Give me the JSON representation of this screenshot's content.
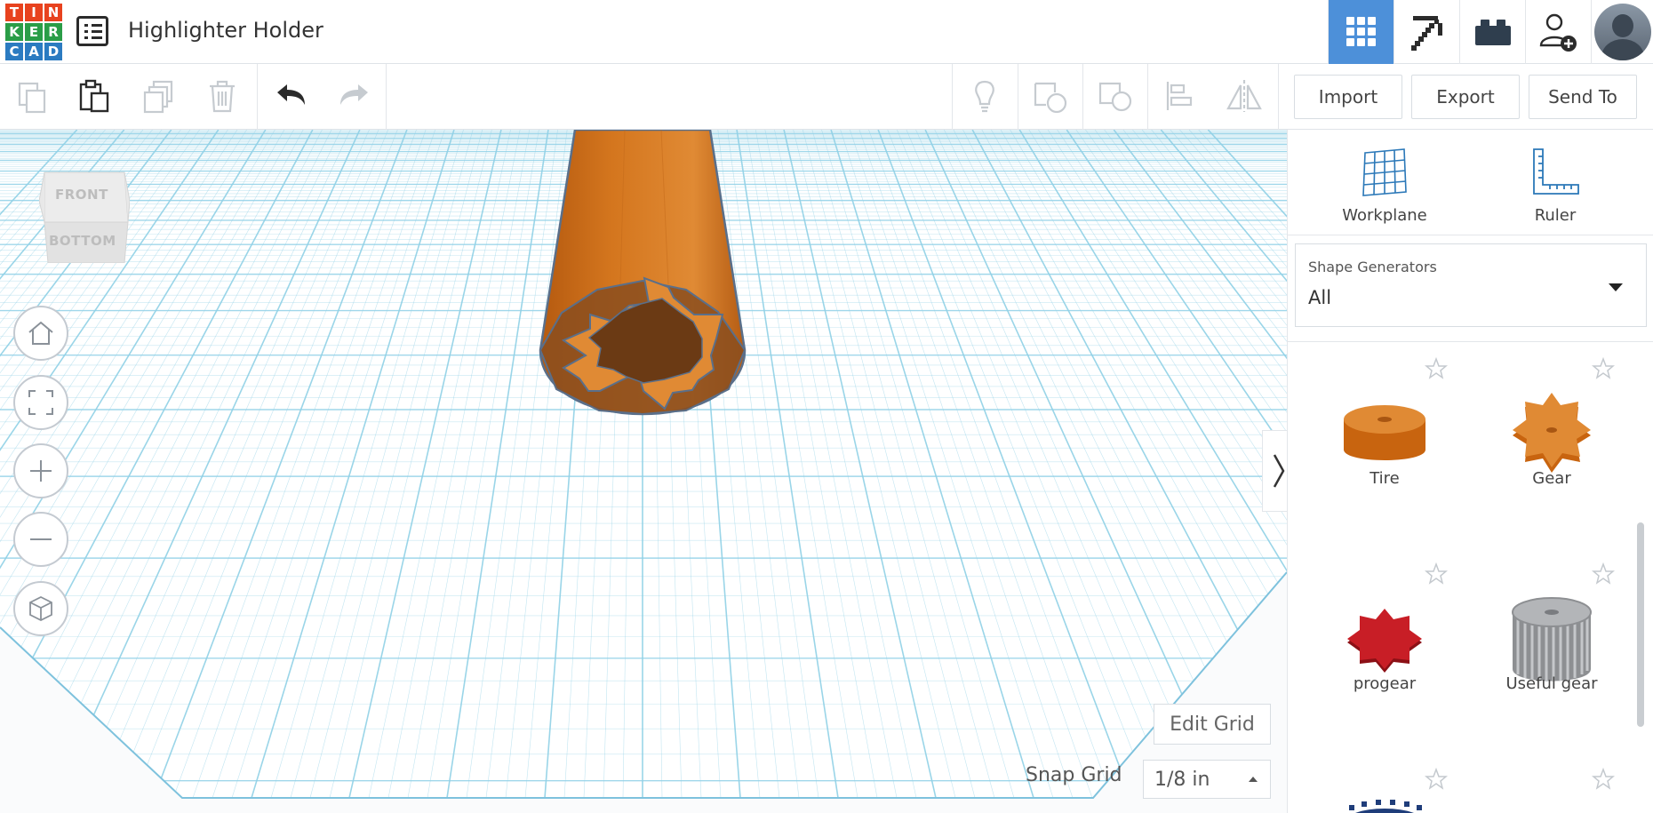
{
  "app": {
    "logo_letters": [
      "T",
      "I",
      "N",
      "K",
      "E",
      "R",
      "C",
      "A",
      "D"
    ],
    "logo_colors": [
      "#e8421e",
      "#e8421e",
      "#e8421e",
      "#2a9d47",
      "#2a9d47",
      "#2a9d47",
      "#2b7bc1",
      "#2b7bc1",
      "#2b7bc1"
    ],
    "design_title": "Highlighter Holder"
  },
  "top_nav": {
    "icons": [
      "grid-view-icon",
      "pickaxe-icon",
      "brick-icon",
      "add-user-icon",
      "avatar"
    ],
    "accent": "#4d90d9"
  },
  "toolbar": {
    "import_label": "Import",
    "export_label": "Export",
    "send_to_label": "Send To"
  },
  "view_cube": {
    "front_label": "FRONT",
    "bottom_label": "BOTTOM"
  },
  "workspace": {
    "edit_grid_label": "Edit Grid",
    "snap_grid_label": "Snap Grid",
    "snap_grid_value": "1/8 in",
    "shape_color": "#d4761e",
    "grid_color": "#8fd0e6"
  },
  "panel": {
    "workplane_label": "Workplane",
    "ruler_label": "Ruler",
    "shape_generators_title": "Shape Generators",
    "shape_generators_value": "All",
    "shapes": [
      {
        "name": "Tire",
        "icon": "tire-shape-icon"
      },
      {
        "name": "Gear",
        "icon": "gear-shape-icon"
      },
      {
        "name": "progear",
        "icon": "progear-shape-icon"
      },
      {
        "name": "Useful gear",
        "icon": "useful-gear-shape-icon"
      }
    ]
  }
}
